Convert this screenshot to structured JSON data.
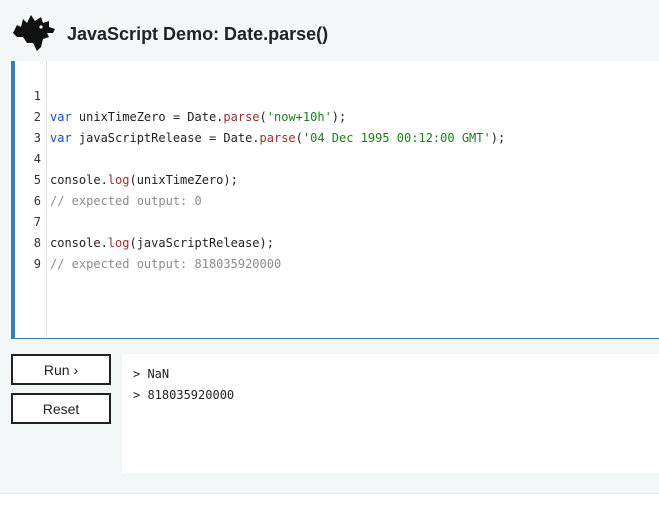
{
  "header": {
    "title": "JavaScript Demo: Date.parse()",
    "logo_icon": "dinosaur-head-icon"
  },
  "editor": {
    "lines": [
      {
        "num": "1"
      },
      {
        "num": "2"
      },
      {
        "num": "3"
      },
      {
        "num": "4"
      },
      {
        "num": "5"
      },
      {
        "num": "6"
      },
      {
        "num": "7"
      },
      {
        "num": "8"
      },
      {
        "num": "9"
      }
    ],
    "tokens": {
      "l1": {
        "a": "var",
        "b": " unixTimeZero = Date.",
        "c": "parse",
        "d": "(",
        "e": "'now+10h'",
        "f": ");"
      },
      "l2": {
        "a": "var",
        "b": " javaScriptRelease = Date.",
        "c": "parse",
        "d": "(",
        "e": "'04 Dec 1995 00:12:00 GMT'",
        "f": ");"
      },
      "l4": {
        "a": "console.",
        "b": "log",
        "c": "(unixTimeZero);"
      },
      "l5": {
        "a": "// expected output: 0"
      },
      "l7": {
        "a": "console.",
        "b": "log",
        "c": "(javaScriptRelease);"
      },
      "l8": {
        "a": "// expected output: 818035920000"
      }
    }
  },
  "buttons": {
    "run_label": "Run ›",
    "reset_label": "Reset"
  },
  "output": {
    "lines": [
      "> NaN",
      "> 818035920000"
    ]
  },
  "colors": {
    "accent": "#3b7fb1",
    "keyword": "#1a4ab3",
    "function": "#9c2f2f",
    "string": "#1c7d1c",
    "comment": "#8c8c8c"
  }
}
